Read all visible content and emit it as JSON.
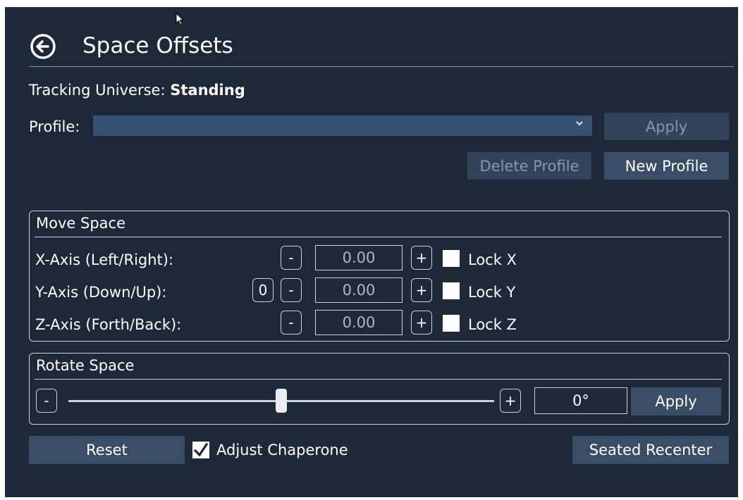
{
  "header": {
    "title": "Space Offsets",
    "back_icon": "arrow-left-circle-icon"
  },
  "tracking": {
    "label": "Tracking Universe:",
    "value": "Standing"
  },
  "profile": {
    "label": "Profile:",
    "selected": "",
    "apply_label": "Apply",
    "delete_label": "Delete Profile",
    "new_label": "New Profile"
  },
  "move_space": {
    "title": "Move Space",
    "minus": "-",
    "plus": "+",
    "zero": "0",
    "axes": [
      {
        "label": "X-Axis (Left/Right):",
        "value": "0.00",
        "lock_label": "Lock X",
        "locked": false
      },
      {
        "label": "Y-Axis (Down/Up):",
        "value": "0.00",
        "lock_label": "Lock Y",
        "locked": false
      },
      {
        "label": "Z-Axis (Forth/Back):",
        "value": "0.00",
        "lock_label": "Lock Z",
        "locked": false
      }
    ]
  },
  "rotate_space": {
    "title": "Rotate Space",
    "minus": "-",
    "plus": "+",
    "slider_fraction": 0.5,
    "value": "0°",
    "apply_label": "Apply"
  },
  "footer": {
    "reset_label": "Reset",
    "adjust_chaperone_label": "Adjust Chaperone",
    "adjust_chaperone_checked": true,
    "seated_recenter_label": "Seated Recenter"
  },
  "colors": {
    "background": "#1d2939",
    "button": "#3a4d66",
    "select": "#395272",
    "border": "#c9d1da"
  }
}
